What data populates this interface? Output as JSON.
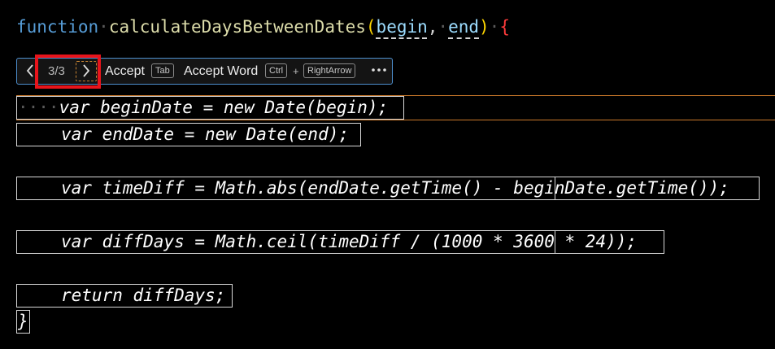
{
  "editor": {
    "signature": {
      "keyword": "function",
      "name": "calculateDaysBetweenDates",
      "open_paren": "(",
      "param1": "begin",
      "comma": ",",
      "param2": "end",
      "close_paren": ")",
      "brace": "{"
    },
    "suggestion_lines": [
      "var beginDate = new Date(begin);",
      "var endDate = new Date(end);",
      "var timeDiff = Math.abs(endDate.getTime() - beginDate.getTime());",
      "var diffDays = Math.ceil(timeDiff / (1000 * 3600 * 24));",
      "return diffDays;",
      "}"
    ],
    "indent_marker": "····"
  },
  "toolbar": {
    "prev_icon": "<",
    "counter": "3/3",
    "next_icon": ">",
    "accept_label": "Accept",
    "accept_key": "Tab",
    "accept_word_label": "Accept Word",
    "accept_word_key1": "Ctrl",
    "plus": "+",
    "accept_word_key2": "RightArrow",
    "more_icon": "•••"
  },
  "colors": {
    "keyword": "#569cd6",
    "function_name": "#dcdcaa",
    "paren": "#ffd700",
    "parameter": "#9cdcfe",
    "brace": "#ff3b3b",
    "toolbar_border": "#4d8fcf",
    "highlight": "#e8141b",
    "current_line": "#c8772a"
  }
}
